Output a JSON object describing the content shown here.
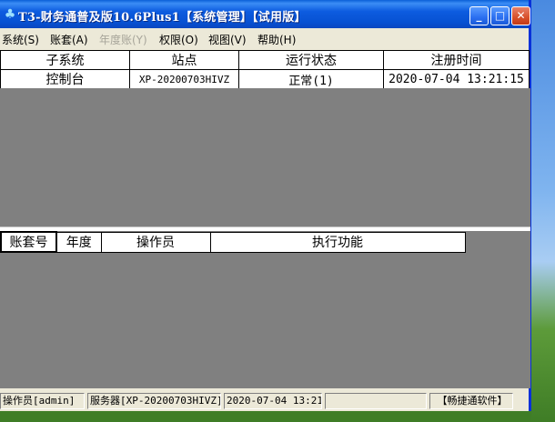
{
  "window": {
    "title": "T3-财务通普及版10.6Plus1【系统管理】【试用版】",
    "buttons": {
      "minimize": "_",
      "maximize": "□",
      "close": "✕"
    }
  },
  "menubar": [
    {
      "label": "系统(S)",
      "disabled": false
    },
    {
      "label": "账套(A)",
      "disabled": false
    },
    {
      "label": "年度账(Y)",
      "disabled": true
    },
    {
      "label": "权限(O)",
      "disabled": false
    },
    {
      "label": "视图(V)",
      "disabled": false
    },
    {
      "label": "帮助(H)",
      "disabled": false
    }
  ],
  "subsystem_table": {
    "headers": [
      "子系统",
      "站点",
      "运行状态",
      "注册时间"
    ],
    "rows": [
      [
        "控制台",
        "XP-20200703HIVZ",
        "正常(1)",
        "2020-07-04 13:21:15"
      ]
    ]
  },
  "task_table": {
    "headers": [
      "账套号",
      "年度",
      "操作员",
      "执行功能"
    ]
  },
  "statusbar": {
    "operator": "操作员[admin]",
    "server": "服务器[XP-20200703HIVZ]",
    "datetime": "2020-07-04 13:21",
    "brand": "【畅捷通软件】"
  }
}
